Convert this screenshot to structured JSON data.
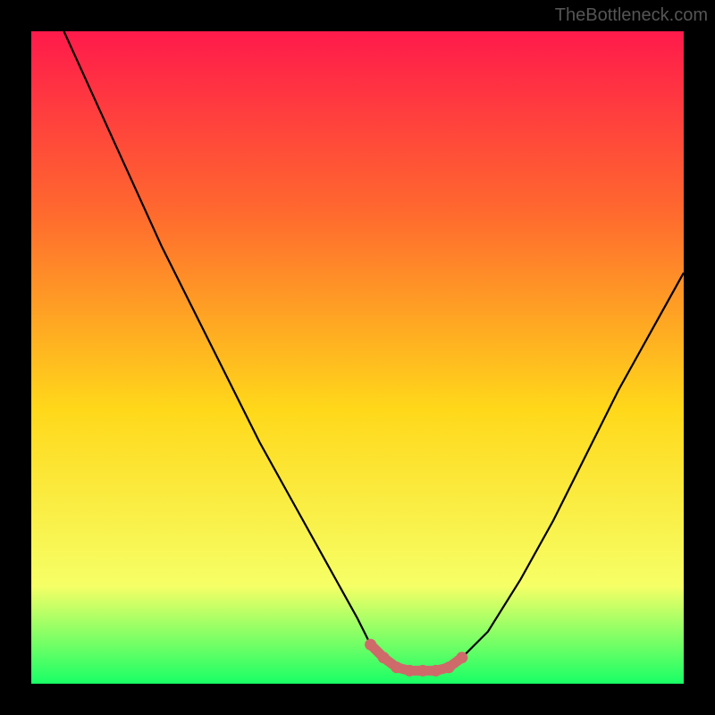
{
  "attribution": "TheBottleneck.com",
  "colors": {
    "gradient_top": "#ff1a4b",
    "gradient_upper_mid": "#ff6a2e",
    "gradient_mid": "#ffd81a",
    "gradient_lower_mid": "#f6ff66",
    "gradient_bottom": "#19ff66",
    "curve": "#000000",
    "marker": "#cf6a6a",
    "frame": "#000000"
  },
  "chart_data": {
    "type": "line",
    "title": "",
    "xlabel": "",
    "ylabel": "",
    "xlim": [
      0,
      100
    ],
    "ylim": [
      0,
      100
    ],
    "series": [
      {
        "name": "bottleneck-curve",
        "x": [
          5,
          10,
          15,
          20,
          25,
          30,
          35,
          40,
          45,
          50,
          52,
          54,
          56,
          58,
          60,
          62,
          64,
          66,
          70,
          75,
          80,
          85,
          90,
          95,
          100
        ],
        "y": [
          100,
          89,
          78,
          67,
          57,
          47,
          37,
          28,
          19,
          10,
          6,
          4,
          2.5,
          2,
          2,
          2,
          2.5,
          4,
          8,
          16,
          25,
          35,
          45,
          54,
          63
        ]
      },
      {
        "name": "optimal-range-marker",
        "x": [
          52,
          54,
          56,
          58,
          60,
          62,
          64,
          66
        ],
        "y": [
          6,
          4,
          2.5,
          2,
          2,
          2,
          2.5,
          4
        ]
      }
    ],
    "annotations": []
  }
}
